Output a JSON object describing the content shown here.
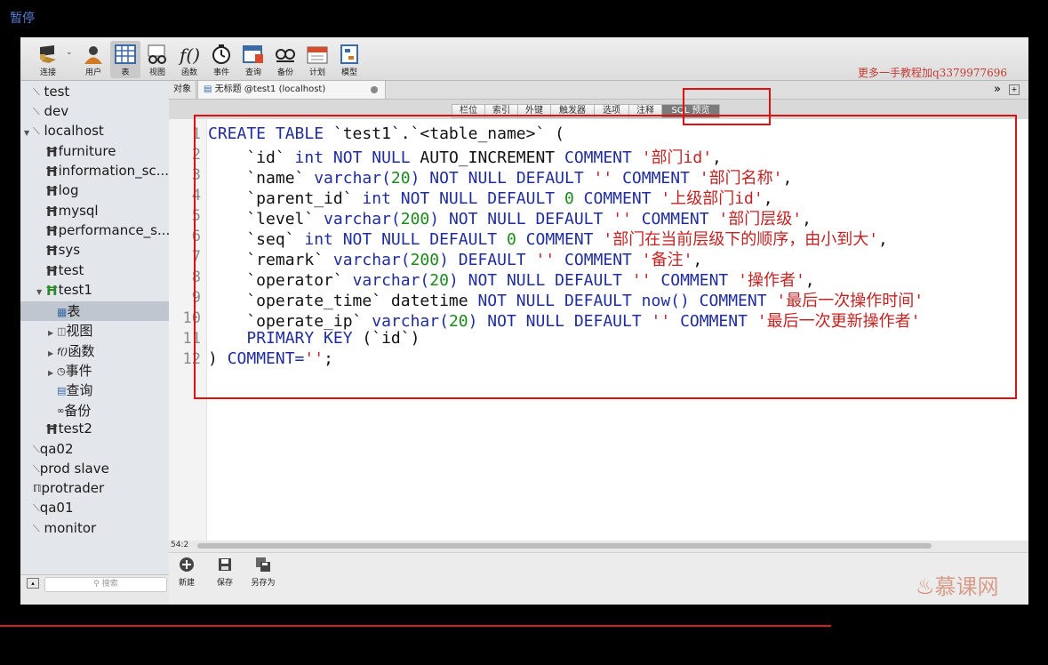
{
  "overlay": {
    "pause_label": "暂停",
    "watermark": "更多一手教程加q3379977696",
    "logo_text": "慕课网"
  },
  "toolbar": {
    "items": [
      {
        "label": "连接",
        "icon": "connection-icon"
      },
      {
        "label": "用户",
        "icon": "user-icon"
      },
      {
        "label": "表",
        "icon": "table-icon"
      },
      {
        "label": "视图",
        "icon": "view-icon"
      },
      {
        "label": "函数",
        "icon": "function-icon"
      },
      {
        "label": "事件",
        "icon": "event-icon"
      },
      {
        "label": "查询",
        "icon": "query-icon"
      },
      {
        "label": "备份",
        "icon": "backup-icon"
      },
      {
        "label": "计划",
        "icon": "schedule-icon"
      },
      {
        "label": "模型",
        "icon": "model-icon"
      }
    ]
  },
  "sidebar": {
    "items": [
      {
        "label": "test",
        "icon": "connection-icon"
      },
      {
        "label": "dev",
        "icon": "connection-icon"
      },
      {
        "label": "localhost",
        "icon": "connection-icon"
      },
      {
        "label": "furniture",
        "icon": "database-icon"
      },
      {
        "label": "information_sc...",
        "icon": "database-icon"
      },
      {
        "label": "log",
        "icon": "database-icon"
      },
      {
        "label": "mysql",
        "icon": "database-icon"
      },
      {
        "label": "performance_s...",
        "icon": "database-icon"
      },
      {
        "label": "sys",
        "icon": "database-icon"
      },
      {
        "label": "test",
        "icon": "database-icon"
      },
      {
        "label": "test1",
        "icon": "database-icon"
      },
      {
        "label": "表",
        "icon": "table-icon"
      },
      {
        "label": "视图",
        "icon": "view-icon"
      },
      {
        "label": "函数",
        "icon": "function-icon"
      },
      {
        "label": "事件",
        "icon": "event-icon"
      },
      {
        "label": "查询",
        "icon": "query-icon"
      },
      {
        "label": "备份",
        "icon": "backup-icon"
      },
      {
        "label": "test2",
        "icon": "database-icon"
      },
      {
        "label": "qa02",
        "icon": "connection-icon"
      },
      {
        "label": "prod slave",
        "icon": "connection-icon"
      },
      {
        "label": "protrader",
        "icon": "connection-icon"
      },
      {
        "label": "qa01",
        "icon": "connection-icon"
      },
      {
        "label": "monitor",
        "icon": "connection-icon"
      }
    ],
    "search_placeholder": "搜索"
  },
  "tabs": {
    "objects": "对象",
    "document": "无标题 @test1 (localhost)",
    "overflow": "»"
  },
  "subtabs": [
    "栏位",
    "索引",
    "外键",
    "触发器",
    "选项",
    "注释",
    "SQL 预览"
  ],
  "editor": {
    "line_numbers": [
      "1",
      "2",
      "3",
      "4",
      "5",
      "6",
      "7",
      "8",
      "9",
      "10",
      "11",
      "12"
    ],
    "cursor_position": "54:2",
    "lines": [
      [
        [
          "kw",
          "CREATE TABLE"
        ],
        [
          "p",
          " `test1`.`<table_name>` ("
        ]
      ],
      [
        [
          "p",
          "    `id` "
        ],
        [
          "kw",
          "int NOT NULL"
        ],
        [
          "p",
          " AUTO_INCREMENT "
        ],
        [
          "kw",
          "COMMENT"
        ],
        [
          "p",
          " "
        ],
        [
          "str",
          "'部门id'"
        ],
        [
          "p",
          ","
        ]
      ],
      [
        [
          "p",
          "    `name` "
        ],
        [
          "kw",
          "varchar("
        ],
        [
          "num",
          "20"
        ],
        [
          "kw",
          ") NOT NULL DEFAULT"
        ],
        [
          "p",
          " "
        ],
        [
          "str",
          "''"
        ],
        [
          "p",
          " "
        ],
        [
          "kw",
          "COMMENT"
        ],
        [
          "p",
          " "
        ],
        [
          "str",
          "'部门名称'"
        ],
        [
          "p",
          ","
        ]
      ],
      [
        [
          "p",
          "    `parent_id` "
        ],
        [
          "kw",
          "int NOT NULL DEFAULT"
        ],
        [
          "p",
          " "
        ],
        [
          "num",
          "0"
        ],
        [
          "p",
          " "
        ],
        [
          "kw",
          "COMMENT"
        ],
        [
          "p",
          " "
        ],
        [
          "str",
          "'上级部门id'"
        ],
        [
          "p",
          ","
        ]
      ],
      [
        [
          "p",
          "    `level` "
        ],
        [
          "kw",
          "varchar("
        ],
        [
          "num",
          "200"
        ],
        [
          "kw",
          ") NOT NULL DEFAULT"
        ],
        [
          "p",
          " "
        ],
        [
          "str",
          "''"
        ],
        [
          "p",
          " "
        ],
        [
          "kw",
          "COMMENT"
        ],
        [
          "p",
          " "
        ],
        [
          "str",
          "'部门层级'"
        ],
        [
          "p",
          ","
        ]
      ],
      [
        [
          "p",
          "    `seq` "
        ],
        [
          "kw",
          "int NOT NULL DEFAULT"
        ],
        [
          "p",
          " "
        ],
        [
          "num",
          "0"
        ],
        [
          "p",
          " "
        ],
        [
          "kw",
          "COMMENT"
        ],
        [
          "p",
          " "
        ],
        [
          "str",
          "'部门在当前层级下的顺序，由小到大'"
        ],
        [
          "p",
          ","
        ]
      ],
      [
        [
          "p",
          "    `remark` "
        ],
        [
          "kw",
          "varchar("
        ],
        [
          "num",
          "200"
        ],
        [
          "kw",
          ") DEFAULT"
        ],
        [
          "p",
          " "
        ],
        [
          "str",
          "''"
        ],
        [
          "p",
          " "
        ],
        [
          "kw",
          "COMMENT"
        ],
        [
          "p",
          " "
        ],
        [
          "str",
          "'备注'"
        ],
        [
          "p",
          ","
        ]
      ],
      [
        [
          "p",
          "    `operator` "
        ],
        [
          "kw",
          "varchar("
        ],
        [
          "num",
          "20"
        ],
        [
          "kw",
          ") NOT NULL DEFAULT"
        ],
        [
          "p",
          " "
        ],
        [
          "str",
          "''"
        ],
        [
          "p",
          " "
        ],
        [
          "kw",
          "COMMENT"
        ],
        [
          "p",
          " "
        ],
        [
          "str",
          "'操作者'"
        ],
        [
          "p",
          ","
        ]
      ],
      [
        [
          "p",
          "    `operate_time` datetime "
        ],
        [
          "kw",
          "NOT NULL DEFAULT now() COMMENT"
        ],
        [
          "p",
          " "
        ],
        [
          "str",
          "'最后一次操作时间'"
        ]
      ],
      [
        [
          "p",
          "    `operate_ip` "
        ],
        [
          "kw",
          "varchar("
        ],
        [
          "num",
          "20"
        ],
        [
          "kw",
          ") NOT NULL DEFAULT"
        ],
        [
          "p",
          " "
        ],
        [
          "str",
          "''"
        ],
        [
          "p",
          " "
        ],
        [
          "kw",
          "COMMENT"
        ],
        [
          "p",
          " "
        ],
        [
          "str",
          "'最后一次更新操作者'"
        ]
      ],
      [
        [
          "p",
          "    "
        ],
        [
          "kw",
          "PRIMARY KEY"
        ],
        [
          "p",
          " (`id`)"
        ]
      ],
      [
        [
          "p",
          ") "
        ],
        [
          "kw",
          "COMMENT="
        ],
        [
          "str",
          "''"
        ],
        [
          "p",
          ";"
        ]
      ]
    ]
  },
  "actions": [
    {
      "label": "新建",
      "icon": "add-icon"
    },
    {
      "label": "保存",
      "icon": "save-icon"
    },
    {
      "label": "另存为",
      "icon": "save-as-icon"
    }
  ],
  "colors": {
    "keyword": "#1f2d9e",
    "number": "#1a8a1a",
    "string": "#c52222",
    "highlight": "#e01010"
  }
}
